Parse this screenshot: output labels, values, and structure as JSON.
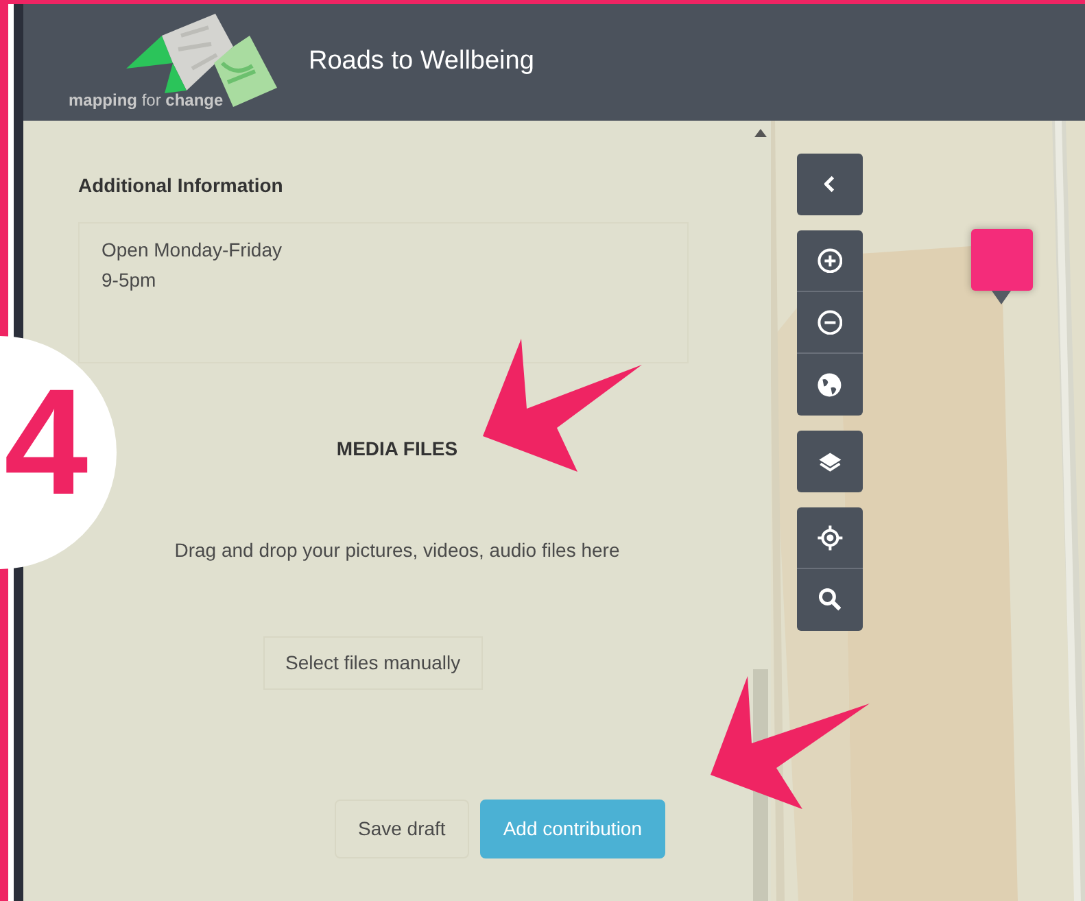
{
  "header": {
    "logo_text": "**mapping** for **change**",
    "title": "Roads to Wellbeing"
  },
  "form": {
    "section_title": "Additional Information",
    "info_text": "Open Monday-Friday\n9-5pm",
    "media_title": "MEDIA FILES",
    "drop_hint": "Drag and drop your pictures, videos, audio files here",
    "select_button": "Select files manually",
    "buttons": [
      {
        "label": "Save draft",
        "kind": "secondary"
      },
      {
        "label": "Add contribution",
        "kind": "primary"
      }
    ]
  },
  "map": {
    "control_groups": [
      {
        "controls": [
          {
            "kind": "collapse"
          }
        ]
      },
      {
        "controls": [
          {
            "kind": "zoom-in"
          },
          {
            "kind": "zoom-out"
          },
          {
            "kind": "world"
          }
        ]
      },
      {
        "controls": [
          {
            "kind": "layers"
          }
        ]
      },
      {
        "controls": [
          {
            "kind": "locate"
          },
          {
            "kind": "search"
          }
        ]
      }
    ]
  },
  "annotation": {
    "step": "4"
  }
}
